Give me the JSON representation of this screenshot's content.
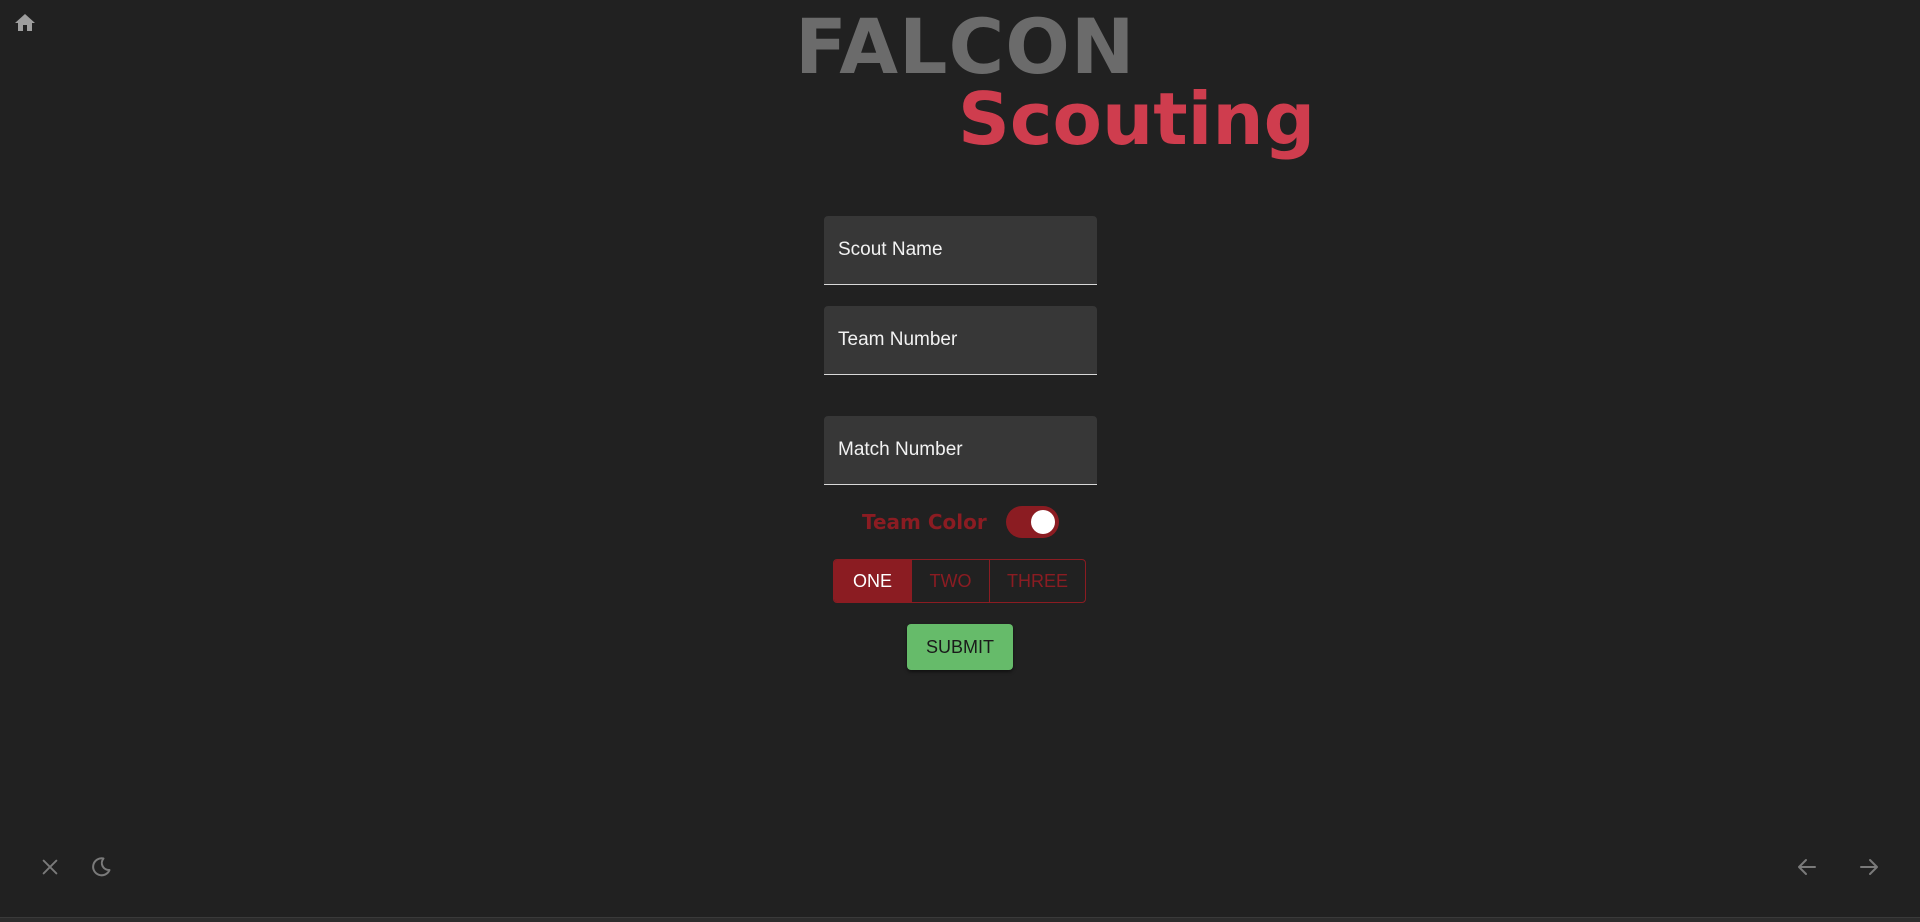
{
  "header": {
    "home_icon": "home-icon",
    "logo_line1": "FALCON",
    "logo_line2": "Scouting"
  },
  "form": {
    "scout_name_placeholder": "Scout Name",
    "team_number_placeholder": "Team Number",
    "match_number_placeholder": "Match Number",
    "team_color_label": "Team Color",
    "team_color_toggle_on": true,
    "positions": [
      "ONE",
      "TWO",
      "THREE"
    ],
    "selected_position": "ONE",
    "submit_label": "SUBMIT"
  },
  "footer": {
    "left_icons": [
      "close-icon",
      "moon-icon"
    ],
    "right_icons": [
      "arrow-left-icon",
      "arrow-right-icon"
    ]
  },
  "colors": {
    "background": "#212121",
    "accent_red": "#8b1c22",
    "logo_red": "#cf3d4e",
    "logo_gray": "#6b6b6b",
    "submit_green": "#66bb6a"
  }
}
